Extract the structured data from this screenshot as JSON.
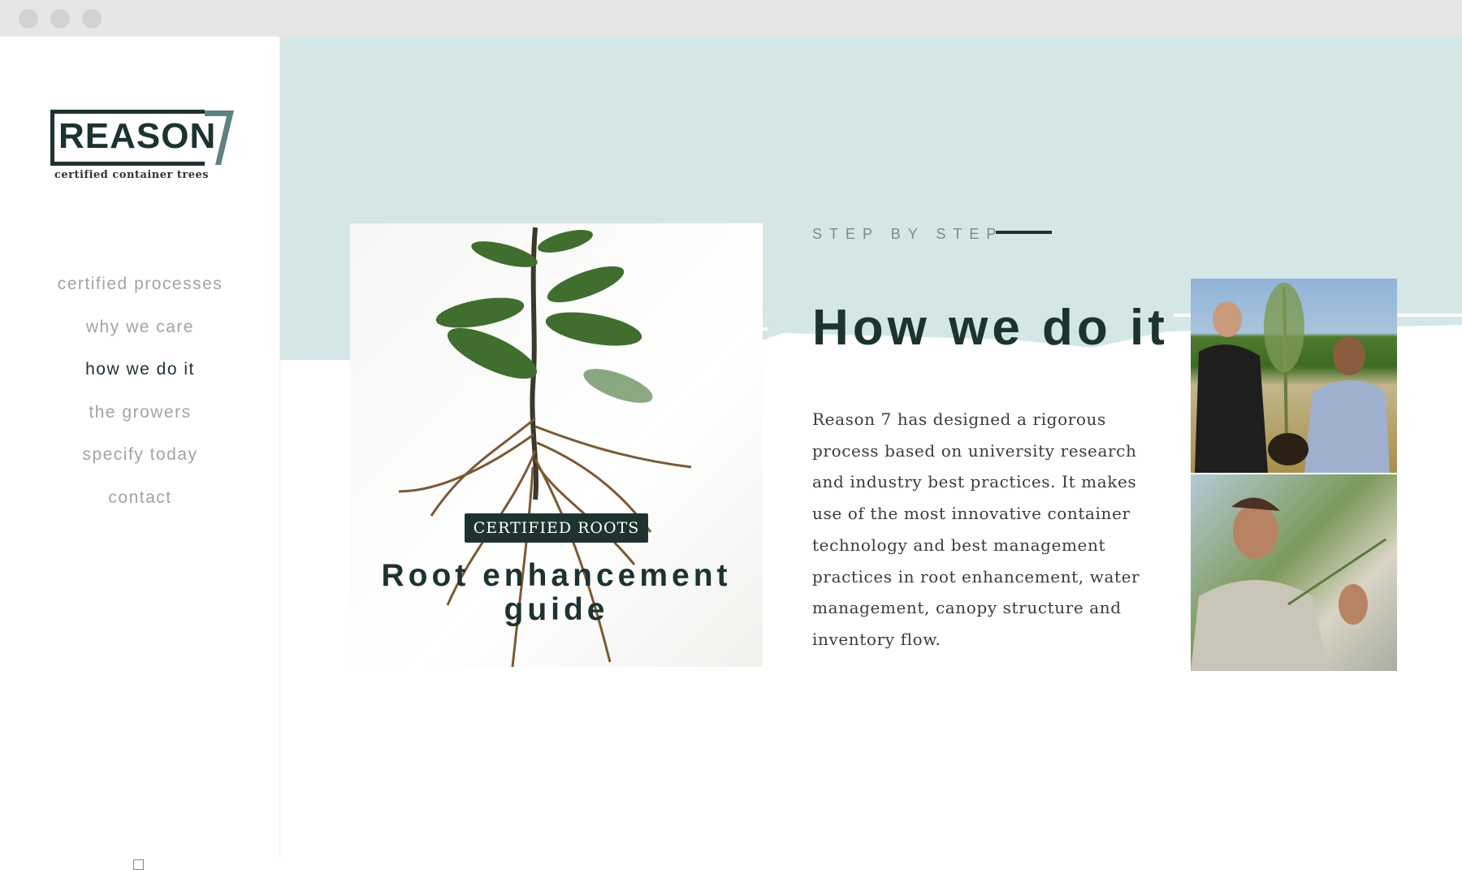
{
  "brand": {
    "name": "REASON",
    "numeral": "7",
    "tagline": "certified container trees"
  },
  "nav": [
    {
      "label": "certified processes",
      "active": false
    },
    {
      "label": "why we care",
      "active": false
    },
    {
      "label": "how we do it",
      "active": true
    },
    {
      "label": "the growers",
      "active": false
    },
    {
      "label": "specify today",
      "active": false
    },
    {
      "label": "contact",
      "active": false
    }
  ],
  "feature": {
    "badge": "CERTIFIED ROOTS",
    "title": "Root enhancement guide"
  },
  "section": {
    "kicker": "STEP BY STEP",
    "heading": "How we do it",
    "body": "Reason 7 has designed a rigorous process based on university research and industry best practices. It makes use of the most innovative container technology and best management practices in root enhancement, water management, canopy structure and inventory flow."
  },
  "colors": {
    "accent": "#1d3330",
    "band": "#d4e7e6"
  }
}
